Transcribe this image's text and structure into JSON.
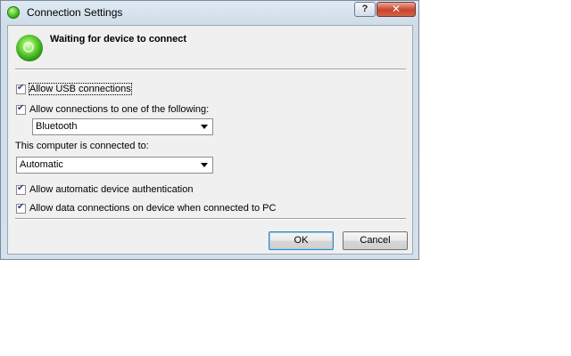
{
  "window": {
    "title": "Connection Settings",
    "help_label": "?",
    "close_label": "✕"
  },
  "header": {
    "status_text": "Waiting for device to connect"
  },
  "options": {
    "allow_usb": {
      "label": "Allow USB connections",
      "checked": true
    },
    "allow_connections_following": {
      "label": "Allow connections to one of the following:",
      "checked": true
    },
    "connection_type": {
      "selected": "Bluetooth"
    },
    "connected_to_label": "This computer is connected to:",
    "connected_to": {
      "selected": "Automatic"
    },
    "allow_auto_auth": {
      "label": "Allow automatic device authentication",
      "checked": true
    },
    "allow_data_connections": {
      "label": "Allow data connections on device when connected to PC",
      "checked": true
    }
  },
  "buttons": {
    "ok_label": "OK",
    "cancel_label": "Cancel"
  },
  "icons": {
    "title_icon": "sync-status-icon",
    "header_icon": "sync-status-icon"
  }
}
